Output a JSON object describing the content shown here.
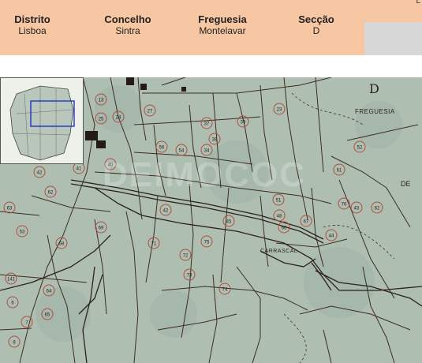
{
  "header": {
    "fields": [
      {
        "label": "Distrito",
        "value": "Lisboa"
      },
      {
        "label": "Concelho",
        "value": "Sintra"
      },
      {
        "label": "Freguesia",
        "value": "Montelavar"
      },
      {
        "label": "Secção",
        "value": "D"
      }
    ]
  },
  "map": {
    "section_letter": "D",
    "place_names": [
      "FREGUESIA",
      "CARRASCAL",
      "DE"
    ],
    "watermark": "DEIMOCOC",
    "parcel_numbers": [
      "27",
      "25",
      "24",
      "13",
      "23",
      "37",
      "38",
      "39",
      "56",
      "54",
      "34",
      "61",
      "62",
      "63",
      "69",
      "68",
      "71",
      "72",
      "73",
      "74",
      "75",
      "76",
      "62",
      "43",
      "44",
      "45",
      "48",
      "51",
      "52",
      "53",
      "141",
      "64",
      "65",
      "67",
      "66",
      "42",
      "41",
      "40",
      "42",
      "6",
      "7",
      "8",
      "9"
    ],
    "colors": {
      "paper": "#aebfb2",
      "lines": "#3d2b24",
      "parcel_circle": "#b14b3b"
    }
  }
}
